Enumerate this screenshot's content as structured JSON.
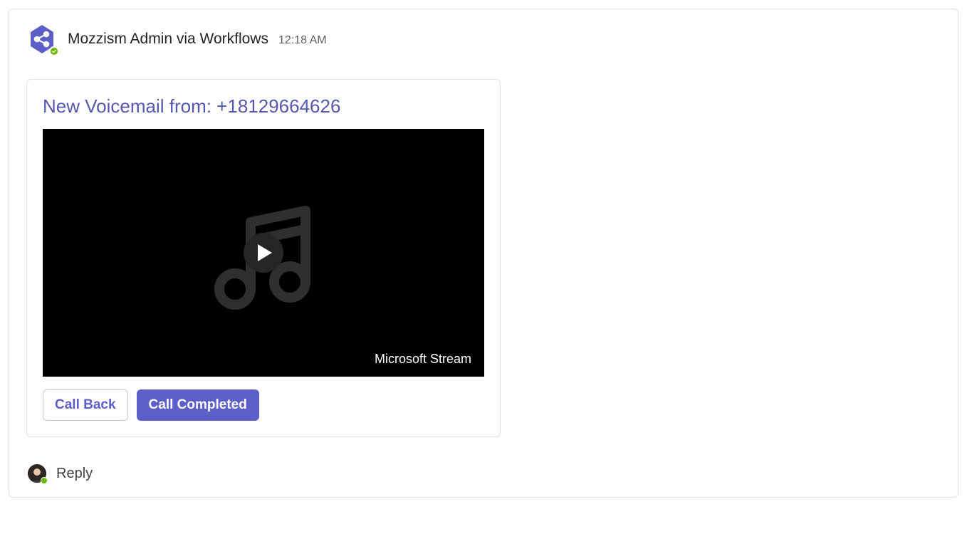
{
  "message": {
    "sender": "Mozzism Admin via Workflows",
    "timestamp": "12:18 AM",
    "avatar_icon": "share-nodes-icon"
  },
  "card": {
    "title": "New Voicemail from: +18129664626",
    "media": {
      "provider_label": "Microsoft Stream",
      "placeholder_icon": "music-note-icon"
    },
    "actions": {
      "call_back": "Call Back",
      "call_completed": "Call Completed"
    }
  },
  "reply": {
    "label": "Reply"
  },
  "colors": {
    "accent": "#5b5fc7",
    "presence_available": "#6bb700"
  }
}
